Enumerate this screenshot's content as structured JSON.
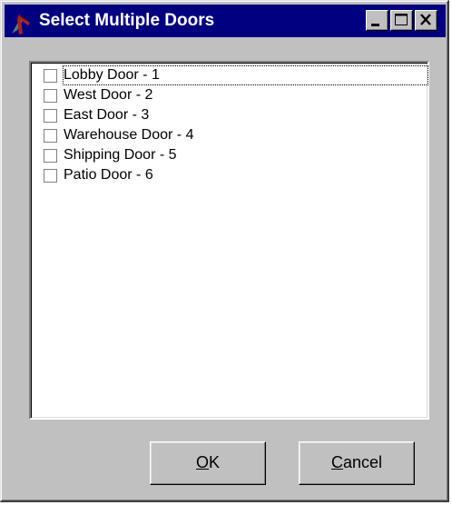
{
  "window": {
    "title": "Select Multiple Doors",
    "title_bar_color": "#000080",
    "face_color": "#c0c0c0"
  },
  "title_buttons": [
    {
      "name": "minimize",
      "icon": "minimize-icon"
    },
    {
      "name": "maximize",
      "icon": "maximize-icon"
    },
    {
      "name": "close",
      "icon": "close-icon"
    }
  ],
  "doors": [
    {
      "label": "Lobby Door - 1",
      "checked": false,
      "focused": true
    },
    {
      "label": "West Door - 2",
      "checked": false,
      "focused": false
    },
    {
      "label": "East Door - 3",
      "checked": false,
      "focused": false
    },
    {
      "label": "Warehouse Door - 4",
      "checked": false,
      "focused": false
    },
    {
      "label": "Shipping Door - 5",
      "checked": false,
      "focused": false
    },
    {
      "label": "Patio Door - 6",
      "checked": false,
      "focused": false
    }
  ],
  "buttons": {
    "ok": {
      "label_rest": "K",
      "mnemonic": "O"
    },
    "cancel": {
      "label_rest": "ancel",
      "mnemonic": "C"
    }
  }
}
